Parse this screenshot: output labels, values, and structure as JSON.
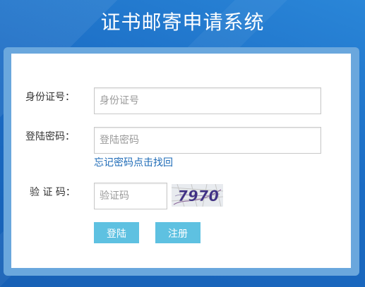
{
  "header": {
    "title": "证书邮寄申请系统"
  },
  "form": {
    "id_label": "身份证号：",
    "id_placeholder": "身份证号",
    "password_label": "登陆密码：",
    "password_placeholder": "登陆密码",
    "forgot_link": "忘记密码点击找回",
    "captcha_label": "验 证 码：",
    "captcha_placeholder": "验证码",
    "captcha_text": "7970"
  },
  "buttons": {
    "login": "登陆",
    "register": "注册"
  },
  "colors": {
    "background": "#1f74c9",
    "button": "#5ec1e1",
    "link": "#1e6bb7"
  }
}
